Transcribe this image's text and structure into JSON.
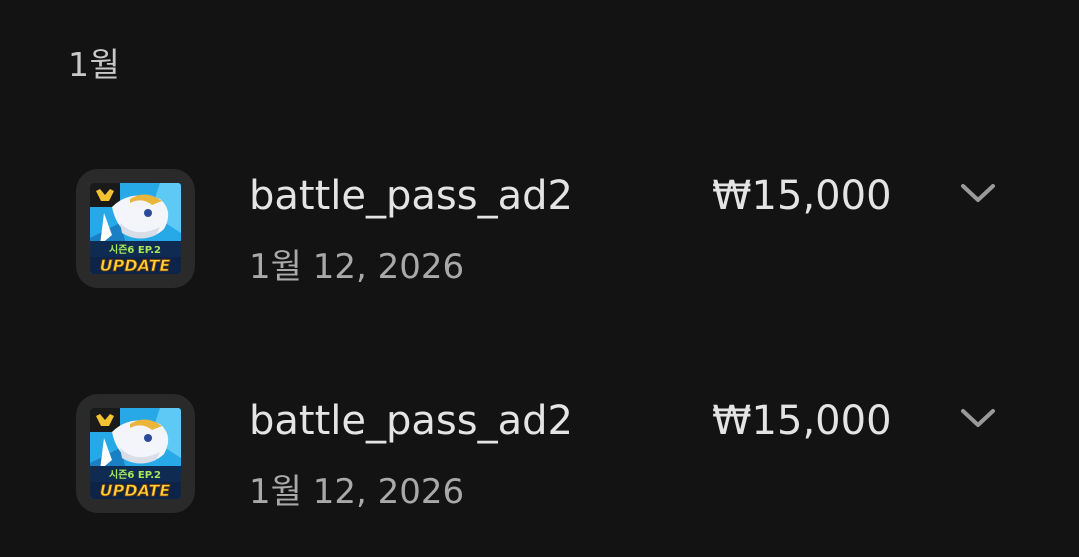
{
  "month_header": "1월",
  "colors": {
    "background": "#131313",
    "primary_text": "#e4e4e4",
    "secondary_text": "#a9a9a9",
    "icon_tile": "#2a2a2b"
  },
  "purchases": [
    {
      "name": "battle_pass_ad2",
      "date": "1월 12, 2026",
      "price": "₩15,000",
      "icon": "game-app-icon",
      "icon_text": "시즌6 EP.2 UPDATE"
    },
    {
      "name": "battle_pass_ad2",
      "date": "1월 12, 2026",
      "price": "₩15,000",
      "icon": "game-app-icon",
      "icon_text": "시즌6 EP.2 UPDATE"
    }
  ]
}
